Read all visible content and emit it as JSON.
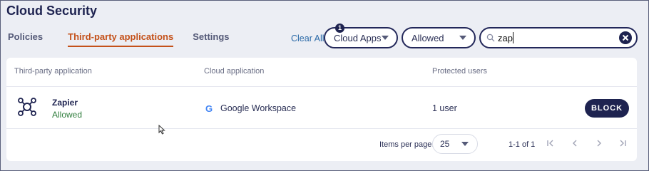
{
  "page": {
    "title": "Cloud Security"
  },
  "tabs": [
    {
      "label": "Policies",
      "active": false
    },
    {
      "label": "Third-party applications",
      "active": true
    },
    {
      "label": "Settings",
      "active": false
    }
  ],
  "filters": {
    "clear_all": "Clear All",
    "cloud_apps": {
      "label": "Cloud Apps",
      "badge": "1"
    },
    "status": {
      "label": "Allowed"
    },
    "search": {
      "value": "zap"
    }
  },
  "table": {
    "headers": [
      "Third-party application",
      "Cloud application",
      "Protected users"
    ],
    "rows": [
      {
        "app_name": "Zapier",
        "status": "Allowed",
        "cloud_icon": "G",
        "cloud_app": "Google Workspace",
        "protected_users": "1 user",
        "action": "BLOCK"
      }
    ]
  },
  "pagination": {
    "items_per_page_label": "Items per page:",
    "items_per_page": "25",
    "range": "1-1 of 1"
  },
  "colors": {
    "primary": "#1e2350",
    "active_tab": "#c4511a",
    "status_allowed": "#2f7d3c",
    "link": "#2b6aa8"
  }
}
